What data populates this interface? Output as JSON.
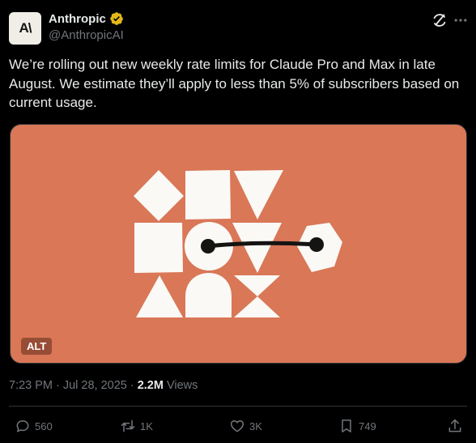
{
  "author": {
    "display_name": "Anthropic",
    "handle": "@AnthropicAI",
    "avatar_text": "A\\"
  },
  "tweet": {
    "text": "We’re rolling out new weekly rate limits for Claude Pro and Max in late August. We estimate they’ll apply to less than 5% of subscribers based on current usage."
  },
  "media": {
    "alt_badge": "ALT"
  },
  "meta": {
    "time": "7:23 PM",
    "separator": "·",
    "date": "Jul 28, 2025",
    "views_count": "2.2M",
    "views_label": "Views"
  },
  "actions": {
    "replies": "560",
    "reposts": "1K",
    "likes": "3K",
    "bookmarks": "749"
  },
  "colors": {
    "media_background": "#d97757",
    "alt_badge": "#974c35",
    "verified_badge": "#e2b719",
    "secondary_text": "#71767b"
  },
  "icons": [
    "verified-badge-icon",
    "grok-icon",
    "more-icon",
    "reply-icon",
    "repost-icon",
    "like-icon",
    "bookmark-icon",
    "share-icon"
  ]
}
